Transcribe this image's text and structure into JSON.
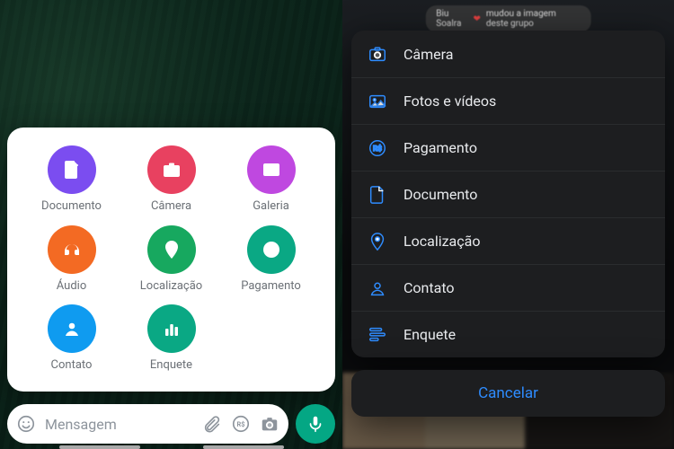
{
  "left": {
    "attachments": [
      {
        "key": "documento",
        "label": "Documento",
        "color": "#7b4df0",
        "icon": "document"
      },
      {
        "key": "camera",
        "label": "Câmera",
        "color": "#e84160",
        "icon": "camera"
      },
      {
        "key": "galeria",
        "label": "Galeria",
        "color": "#bf48e0",
        "icon": "gallery"
      },
      {
        "key": "audio",
        "label": "Áudio",
        "color": "#f36a23",
        "icon": "headphones"
      },
      {
        "key": "localizacao",
        "label": "Localização",
        "color": "#17a85f",
        "icon": "pin"
      },
      {
        "key": "pagamento",
        "label": "Pagamento",
        "color": "#0aa884",
        "icon": "payment"
      },
      {
        "key": "contato",
        "label": "Contato",
        "color": "#0f9bf0",
        "icon": "contact"
      },
      {
        "key": "enquete",
        "label": "Enquete",
        "color": "#0aa884",
        "icon": "poll"
      }
    ],
    "message_placeholder": "Mensagem",
    "msgbar_icons": {
      "emoji": "emoji",
      "attach": "paperclip",
      "pay": "R$",
      "cam": "camera"
    }
  },
  "right": {
    "system_hint": {
      "prefix": "Biu Soalra",
      "suffix": "mudou a imagem deste grupo"
    },
    "options": [
      {
        "label": "Câmera",
        "icon": "camera"
      },
      {
        "label": "Fotos e vídeos",
        "icon": "gallery"
      },
      {
        "label": "Pagamento",
        "icon": "payment"
      },
      {
        "label": "Documento",
        "icon": "document"
      },
      {
        "label": "Localização",
        "icon": "pin"
      },
      {
        "label": "Contato",
        "icon": "contact"
      },
      {
        "label": "Enquete",
        "icon": "poll"
      }
    ],
    "cancel_label": "Cancelar"
  }
}
